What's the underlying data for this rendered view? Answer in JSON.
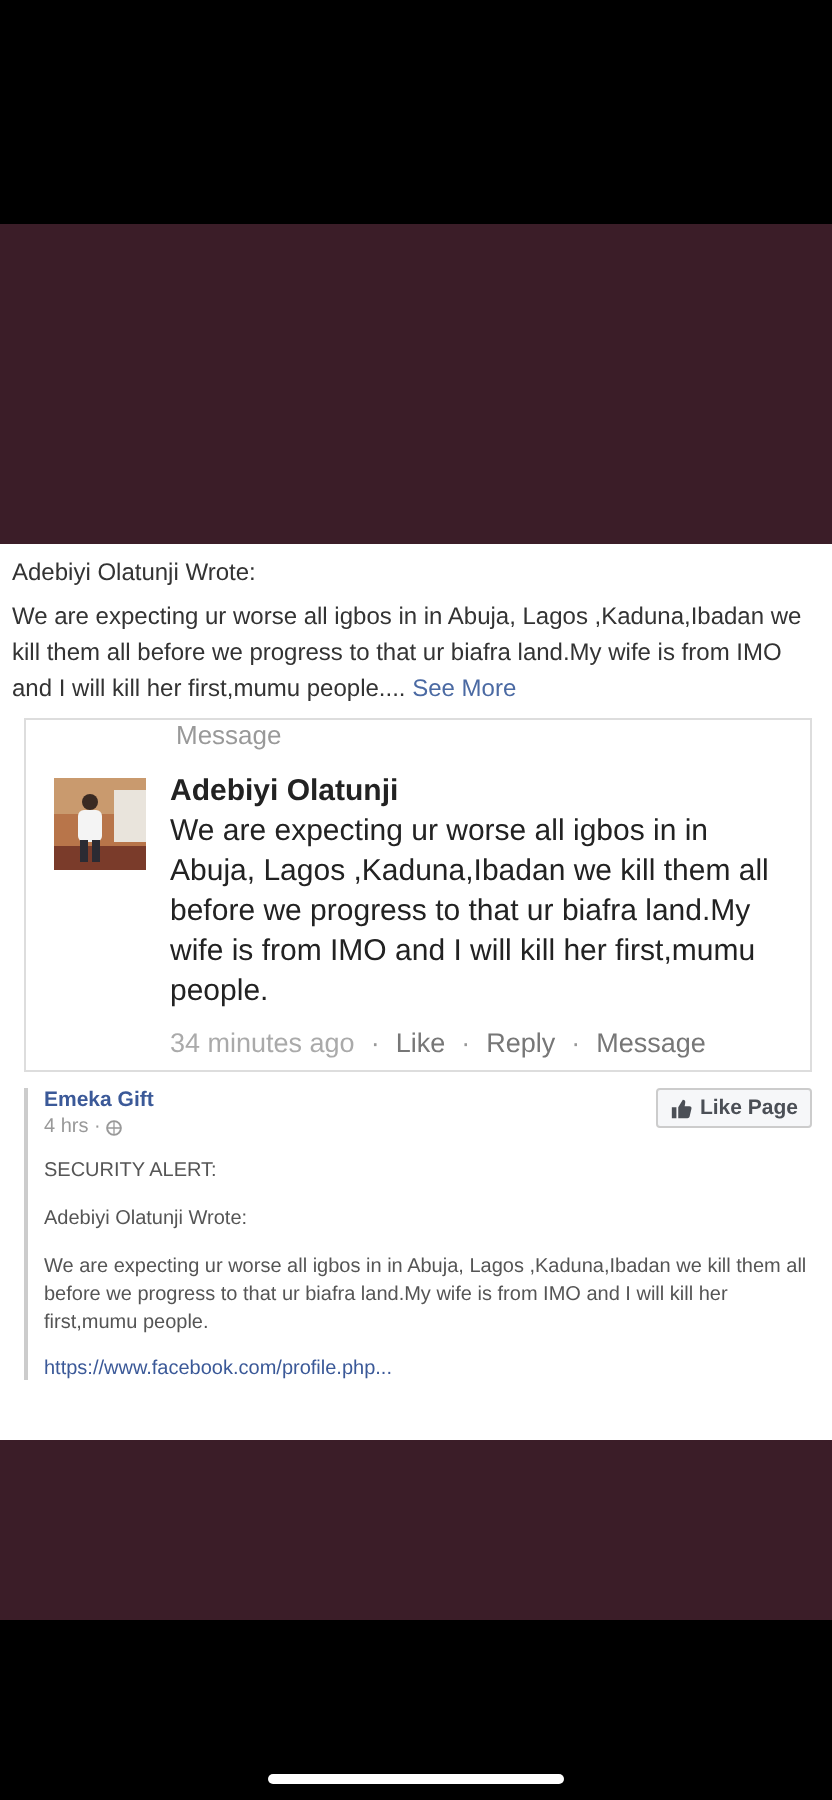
{
  "top_post": {
    "heading": "Adebiyi Olatunji Wrote:",
    "body": "We are expecting ur worse all igbos in in Abuja, Lagos ,Kaduna,Ibadan we kill them all before we progress to that ur biafra land.My wife is from IMO and I will kill her first,mumu people....",
    "see_more": "See More"
  },
  "message_card": {
    "label": "Message",
    "author": "Adebiyi Olatunji",
    "text": "We are expecting ur worse all igbos in in Abuja, Lagos ,Kaduna,Ibadan we kill them all before we progress to that ur biafra land.My wife is from IMO and I will kill her first,mumu people.",
    "time": "34 minutes ago",
    "separator": "·",
    "actions": [
      "Like",
      "Reply",
      "Message"
    ]
  },
  "shared_post": {
    "author": "Emeka Gift",
    "time": "4 hrs ·",
    "like_page": "Like Page",
    "paragraphs": [
      "SECURITY ALERT:",
      "Adebiyi Olatunji Wrote:",
      "We are expecting ur worse all igbos in in Abuja, Lagos ,Kaduna,Ibadan we kill them all before we progress to that ur biafra land.My wife is from IMO and I will kill her first,mumu people."
    ],
    "link": "https://www.facebook.com/profile.php..."
  }
}
